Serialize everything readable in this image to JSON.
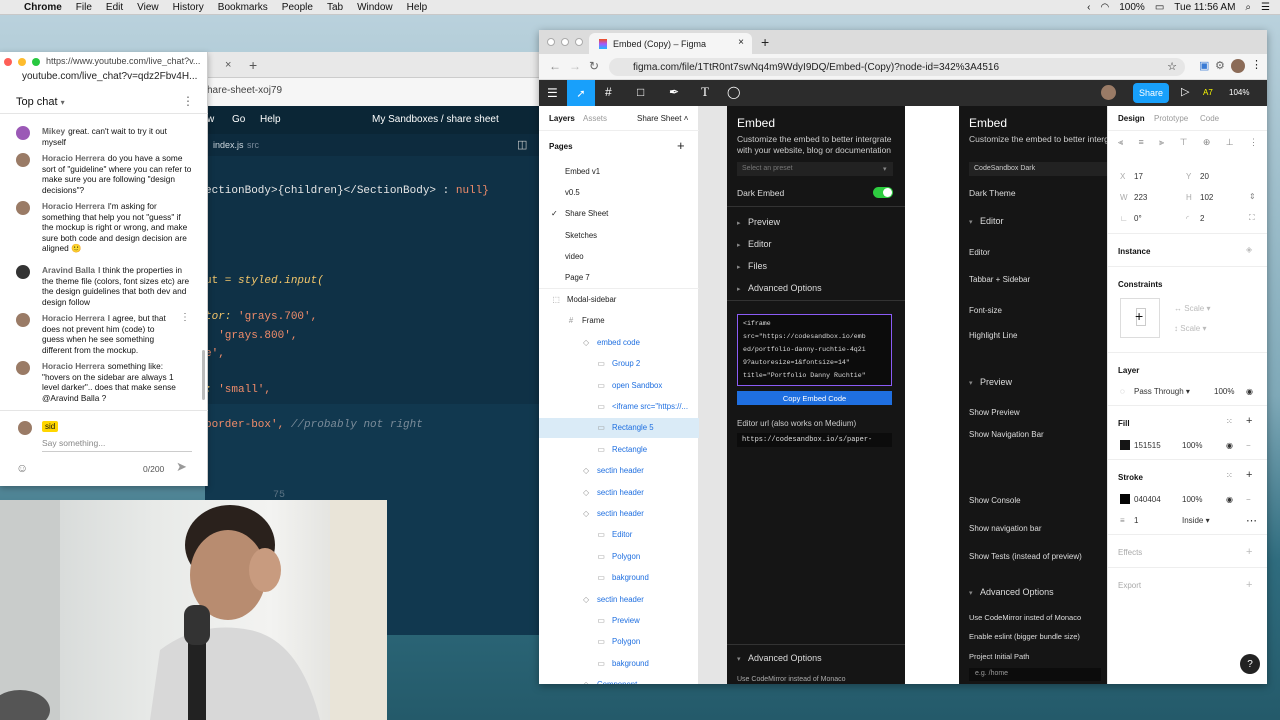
{
  "menubar": {
    "app": "Chrome",
    "items": [
      "File",
      "Edit",
      "View",
      "History",
      "Bookmarks",
      "People",
      "Tab",
      "Window",
      "Help"
    ],
    "battery": "100%",
    "clock": "Tue 11:56 AM"
  },
  "chat": {
    "url_top": "https://www.youtube.com/live_chat?v...",
    "url": "youtube.com/live_chat?v=qdz2Fbv4H...",
    "header": "Top chat",
    "messages": [
      {
        "author": "Mikey",
        "text": "great. can't wait to try it out myself"
      },
      {
        "author": "Horacio Herrera",
        "text": "do you have a some sort of \"guideline\" where you can refer to make sure you are following \"design decisions\"?"
      },
      {
        "author": "Horacio Herrera",
        "text": "I'm asking for something that help you not \"guess\" if the mockup is right or wrong, and make sure both code and design decision are aligned 🙂"
      },
      {
        "author": "Aravind Balla",
        "text": "I think the properties in the theme file (colors, font sizes etc) are the design guidelines that both dev and design follow"
      },
      {
        "author": "Horacio Herrera",
        "text": "I agree, but that does not prevent him (code) to guess when he see something different from the mockup."
      },
      {
        "author": "Horacio Herrera",
        "text": "something like: \"hovers on the sidebar are always 1 level darker\".. does that make sense @Aravind Balla ?"
      }
    ],
    "input_user": "sid",
    "placeholder": "Say something...",
    "counter": "0/200"
  },
  "code": {
    "tab_partial": "hare-sheet-xoj79",
    "menu": [
      "w",
      "Go",
      "Help"
    ],
    "crumb": "My Sandboxes / share sheet",
    "file": "index.js",
    "file_dir": "src",
    "line_no": "75",
    "lines": [
      {
        "pre": "ectionBody>{children}</SectionBody> : ",
        "kw": "null}"
      },
      {
        "pre": "ut = ",
        "kw": "styled.input("
      },
      {
        "pre": "tor: ",
        "kw": "'grays.700',"
      },
      {
        "pre": "  ",
        "kw": "'grays.800',"
      },
      {
        "pre": "e',",
        "kw": ""
      },
      {
        "pre": ": ",
        "kw": "'small',"
      },
      {
        "pre": "border-box', ",
        "kw": "//probably not right"
      }
    ]
  },
  "figma": {
    "tab": "Embed (Copy) – Figma",
    "url": "figma.com/file/1TtR0nt7swNq4m9WdyI9DQ/Embed-(Copy)?node-id=342%3A4516",
    "share": "Share",
    "zoom": "104%",
    "layers_tab": "Layers",
    "assets_tab": "Assets",
    "page_name": "Share Sheet",
    "pages_label": "Pages",
    "pages": [
      "Embed v1",
      "v0.5",
      "Share Sheet",
      "Sketches",
      "video",
      "Page 7"
    ],
    "layers": [
      {
        "name": "Modal-sidebar",
        "indent": 0
      },
      {
        "name": "Frame",
        "indent": 1
      },
      {
        "name": "embed code",
        "indent": 2,
        "blue": true
      },
      {
        "name": "Group 2",
        "indent": 3,
        "blue": true
      },
      {
        "name": "open Sandbox",
        "indent": 3,
        "blue": true
      },
      {
        "name": "<iframe src=\"https://...",
        "indent": 3,
        "blue": true
      },
      {
        "name": "Rectangle 5",
        "indent": 3,
        "blue": true,
        "selected": true
      },
      {
        "name": "Rectangle",
        "indent": 3,
        "blue": true
      },
      {
        "name": "sectin header",
        "indent": 2,
        "blue": true
      },
      {
        "name": "sectin header",
        "indent": 2,
        "blue": true
      },
      {
        "name": "sectin header",
        "indent": 2,
        "blue": true
      },
      {
        "name": "Editor",
        "indent": 3,
        "blue": true
      },
      {
        "name": "Polygon",
        "indent": 3,
        "blue": true
      },
      {
        "name": "bakground",
        "indent": 3,
        "blue": true
      },
      {
        "name": "sectin header",
        "indent": 2,
        "blue": true
      },
      {
        "name": "Preview",
        "indent": 3,
        "blue": true
      },
      {
        "name": "Polygon",
        "indent": 3,
        "blue": true
      },
      {
        "name": "bakground",
        "indent": 3,
        "blue": true
      },
      {
        "name": "Component",
        "indent": 2,
        "blue": true
      }
    ],
    "embed1": {
      "title": "Embed",
      "desc": "Customize the embed to better intergrate with your website, blog or documentation",
      "preset": "Select an preset",
      "dark": "Dark Embed",
      "sections": [
        "Preview",
        "Editor",
        "Files",
        "Advanced Options"
      ],
      "code": "<iframe\nsrc=\"https://codesandbox.io/emb\ned/portfolio-danny-ruchtie-4q2i\n9?autoresize=1&fontsize=14\"\ntitle=\"Portfolio Danny Ruchtie\"",
      "copy": "Copy Embed Code",
      "editor_url_label": "Editor url (also works on Medium)",
      "editor_url": "https://codesandbox.io/s/paper-",
      "adv2": "Advanced Options",
      "adv2_sub": "Use CodeMirror instead of Monaco"
    },
    "embed2": {
      "title": "Embed",
      "desc": "Customize the embed to better intergrate with your website, blog or documentation",
      "preset": "CodeSandbox Dark",
      "theme": "Dark Theme",
      "editor_header": "Editor",
      "editor_items": [
        "Editor",
        "Tabbar + Sidebar",
        "Font-size",
        "Highlight Line"
      ],
      "preview_header": "Preview",
      "preview_items": [
        "Show Preview",
        "Show Navigation Bar",
        "Show Console",
        "Show navigation bar",
        "Show Tests (instead of preview)"
      ],
      "adv_header": "Advanced Options",
      "adv_items": [
        "Use CodeMirror insted of Monaco",
        "Enable eslint (bigger bundle size)",
        "Project Initial Path"
      ],
      "path_placeholder": "e.g. /home"
    },
    "right": {
      "tabs": [
        "Design",
        "Prototype",
        "Code"
      ],
      "x": "17",
      "y": "20",
      "w": "223",
      "h": "102",
      "rot": "0°",
      "radius": "2",
      "instance": "Instance",
      "constraints": "Constraints",
      "scale": "Scale",
      "layer": "Layer",
      "blend": "Pass Through",
      "layer_op": "100%",
      "fill": "Fill",
      "fill_hex": "151515",
      "fill_op": "100%",
      "fill_color": "#151515",
      "stroke": "Stroke",
      "stroke_hex": "040404",
      "stroke_op": "100%",
      "stroke_color": "#040404",
      "stroke_w": "1",
      "stroke_pos": "Inside",
      "effects": "Effects",
      "export": "Export"
    }
  }
}
